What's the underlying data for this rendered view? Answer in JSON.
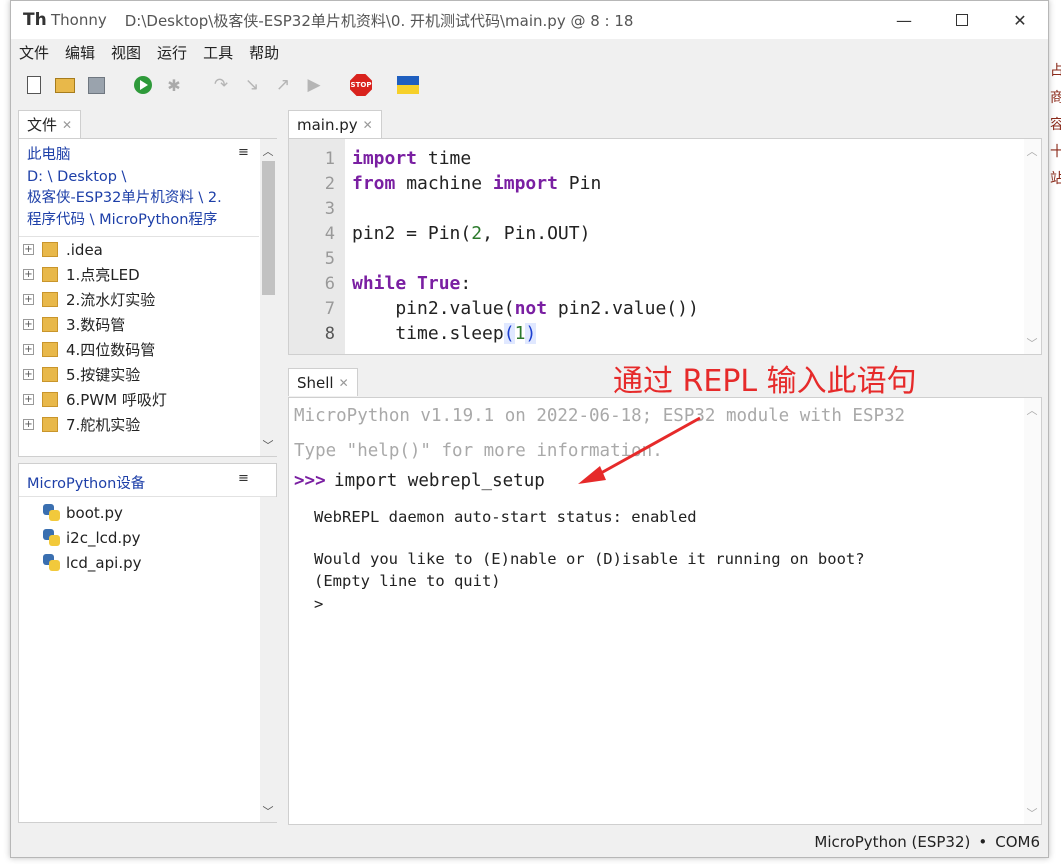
{
  "window": {
    "app_name": "Thonny",
    "title": "D:\\Desktop\\极客侠-ESP32单片机资料\\0. 开机测试代码\\main.py  @  8 : 18"
  },
  "background_right_text": [
    "占",
    "商",
    "容",
    "十",
    "站"
  ],
  "menu": [
    "文件",
    "编辑",
    "视图",
    "运行",
    "工具",
    "帮助"
  ],
  "files_panel": {
    "tab_label": "文件",
    "path_lines": [
      "此电脑",
      "D: \\ Desktop \\",
      "极客侠-ESP32单片机资料 \\ 2.",
      "程序代码 \\ MicroPython程序"
    ],
    "items": [
      ".idea",
      "1.点亮LED",
      "2.流水灯实验",
      "3.数码管",
      "4.四位数码管",
      "5.按键实验",
      "6.PWM 呼吸灯",
      "7.舵机实验"
    ]
  },
  "device_panel": {
    "title": "MicroPython设备",
    "items": [
      "boot.py",
      "i2c_lcd.py",
      "lcd_api.py"
    ]
  },
  "editor": {
    "tab_label": "main.py",
    "line_numbers": [
      "1",
      "2",
      "3",
      "4",
      "5",
      "6",
      "7",
      "8"
    ],
    "lines": [
      {
        "a": "import",
        "b": " time"
      },
      {
        "a": "from",
        "b": " machine ",
        "c": "import",
        "d": " Pin"
      },
      {},
      {
        "a": "pin2 = Pin(",
        "b": "2",
        "c": ", Pin.OUT)"
      },
      {},
      {
        "a": "while",
        "b": " ",
        "c": "True",
        "d": ":"
      },
      {
        "a": "    pin2.value(",
        "b": "not",
        "c": " pin2.value())"
      },
      {
        "a": "    time.sleep",
        "b": "(",
        "c": "1",
        "d": ")"
      }
    ]
  },
  "shell": {
    "tab_label": "Shell",
    "banner": "MicroPython v1.19.1 on 2022-06-18; ESP32 module with ESP32",
    "help_hint": "Type \"help()\" for more information.",
    "prompt": ">>>",
    "command": "import webrepl_setup",
    "output": [
      "WebREPL daemon auto-start status: enabled",
      "",
      "Would you like to (E)nable or (D)isable it running on boot?",
      "(Empty line to quit)",
      ">"
    ]
  },
  "annotation": {
    "text": "通过 REPL 输入此语句",
    "color": "#e62a2a"
  },
  "status_bar": {
    "interpreter": "MicroPython (ESP32)",
    "separator": "•",
    "port": "COM6"
  }
}
